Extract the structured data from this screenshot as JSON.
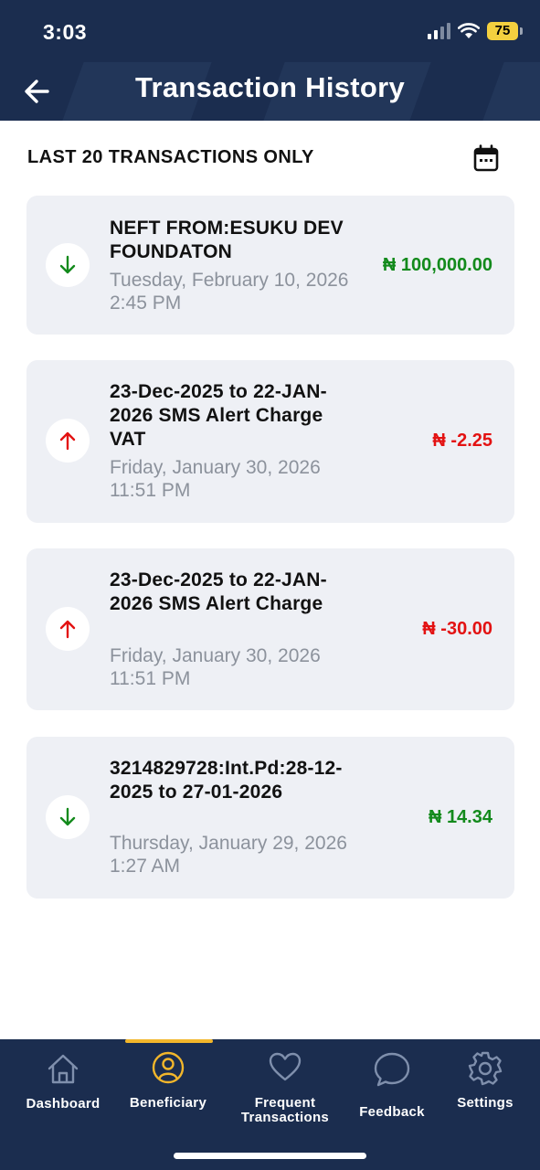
{
  "status_bar": {
    "time": "3:03",
    "battery": "75"
  },
  "header": {
    "title": "Transaction History",
    "back_icon": "arrow-left-icon"
  },
  "subheader": {
    "label": "LAST 20 TRANSACTIONS ONLY",
    "calendar_icon": "calendar-icon"
  },
  "colors": {
    "header_bg": "#1b2d4f",
    "card_bg": "#eef0f5",
    "credit": "#138a1c",
    "debit": "#e31212",
    "active_accent": "#f2b62b"
  },
  "transactions": [
    {
      "direction": "credit",
      "icon": "arrow-down-icon",
      "description": "NEFT FROM:ESUKU DEV FOUNDATON",
      "date": "Tuesday, February 10, 2026 2:45 PM",
      "amount": "₦ 100,000.00"
    },
    {
      "direction": "debit",
      "icon": "arrow-up-icon",
      "description": "23-Dec-2025 to 22-JAN-2026 SMS Alert Charge VAT",
      "date": "Friday, January 30, 2026 11:51 PM",
      "amount": "₦ -2.25"
    },
    {
      "direction": "debit",
      "icon": "arrow-up-icon",
      "description": "23-Dec-2025 to 22-JAN-2026 SMS Alert Charge",
      "date": "Friday, January 30, 2026 11:51 PM",
      "amount": "₦ -30.00"
    },
    {
      "direction": "credit",
      "icon": "arrow-down-icon",
      "description": "3214829728:Int.Pd:28-12-2025 to 27-01-2026",
      "date": "Thursday, January 29, 2026 1:27 AM",
      "amount": "₦ 14.34"
    }
  ],
  "bottom_nav": {
    "active": "Beneficiary",
    "items": [
      {
        "label": "Dashboard",
        "icon": "home-icon"
      },
      {
        "label": "Beneficiary",
        "icon": "user-circle-icon"
      },
      {
        "label": "Frequent Transactions",
        "icon": "heart-icon"
      },
      {
        "label": "Feedback",
        "icon": "chat-bubble-icon"
      },
      {
        "label": "Settings",
        "icon": "gear-icon"
      }
    ]
  }
}
